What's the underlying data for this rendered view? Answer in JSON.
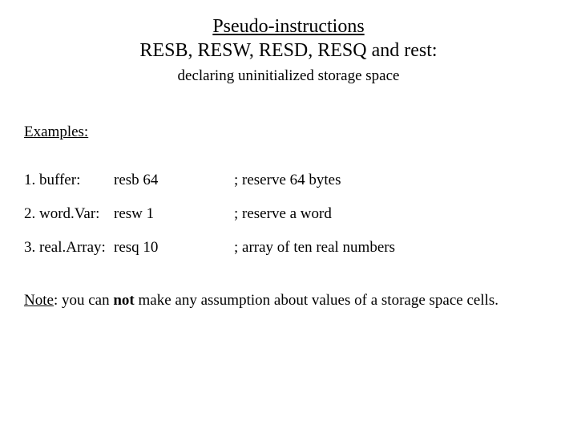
{
  "title": {
    "line1": "Pseudo-instructions",
    "line2": "RESB, RESW, RESD, RESQ and rest:"
  },
  "subtitle": "declaring uninitialized storage space",
  "examples_heading": "Examples:",
  "examples": [
    {
      "label": "1. buffer:",
      "instr": "resb 64",
      "comment": "; reserve 64 bytes"
    },
    {
      "label": "2. word.Var:",
      "instr": "resw 1",
      "comment": "; reserve a word"
    },
    {
      "label": "3. real.Array:",
      "instr": "resq 10",
      "comment": "; array of ten real numbers"
    }
  ],
  "note": {
    "lead": "Note",
    "before_bold": ": you can ",
    "bold": "not",
    "after_bold": " make any assumption about values of a storage space cells."
  }
}
